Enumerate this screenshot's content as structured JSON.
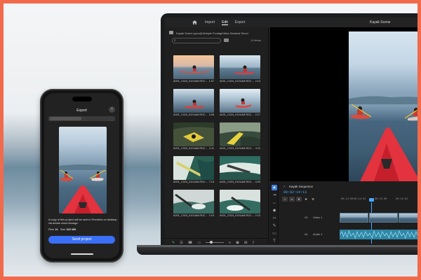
{
  "laptop": {
    "menu": {
      "import": "Import",
      "edit": "Edit",
      "export": "Export",
      "title": "Kayak Scene"
    },
    "project": {
      "path": "Kayak Scene.prproj\\Lifestyle Footage\\New Zealand Shoot",
      "item_count": "11 items",
      "clips": [
        {
          "name": "A001_C024_0101AM.RDC...",
          "duration": "1:07"
        },
        {
          "name": "A001_C024_0101AM.RDC...",
          "duration": "2:13"
        },
        {
          "name": "A001_C024_0101AM.RDC...",
          "duration": "3:08"
        },
        {
          "name": "A001_C024_0101AM.RDC...",
          "duration": "2:17"
        },
        {
          "name": "A001_C024_0101AM.RDC...",
          "duration": "2:11"
        },
        {
          "name": "A001_C024_0101AM.RDC...",
          "duration": "4:11"
        },
        {
          "name": "A001_C024_0101AM.RDC...",
          "duration": "7:15"
        },
        {
          "name": "A001_C024_0101AM.RDC...",
          "duration": "4:03"
        },
        {
          "name": "A001_C024_0101AM.RDC...",
          "duration": "2:16"
        },
        {
          "name": "A001_C024_0101AM.RDC...",
          "duration": "2:13"
        }
      ]
    },
    "timeline": {
      "sequence_name": "Kayak Sequence",
      "timecode": "00:02:14:13",
      "ruler": [
        "00:14:00",
        "00:14:02",
        "00:15:00",
        "00:15:02"
      ],
      "tracks": {
        "video_label": "V1",
        "video_name": "Video 1",
        "audio_label": "A1",
        "audio_name": "Audio 1"
      }
    },
    "colors": {
      "accent": "#4aa8ff",
      "clip_audio": "#2f87a7"
    }
  },
  "phone": {
    "title": "Export",
    "description": "A copy of this project will be sent to Premiere on desktop via Adobe cloud storage.",
    "files_label": "Files",
    "files_value": "16",
    "size_label": "Size",
    "size_value": "520 MB",
    "button": "Send project",
    "colors": {
      "button": "#3a6ff7"
    }
  }
}
